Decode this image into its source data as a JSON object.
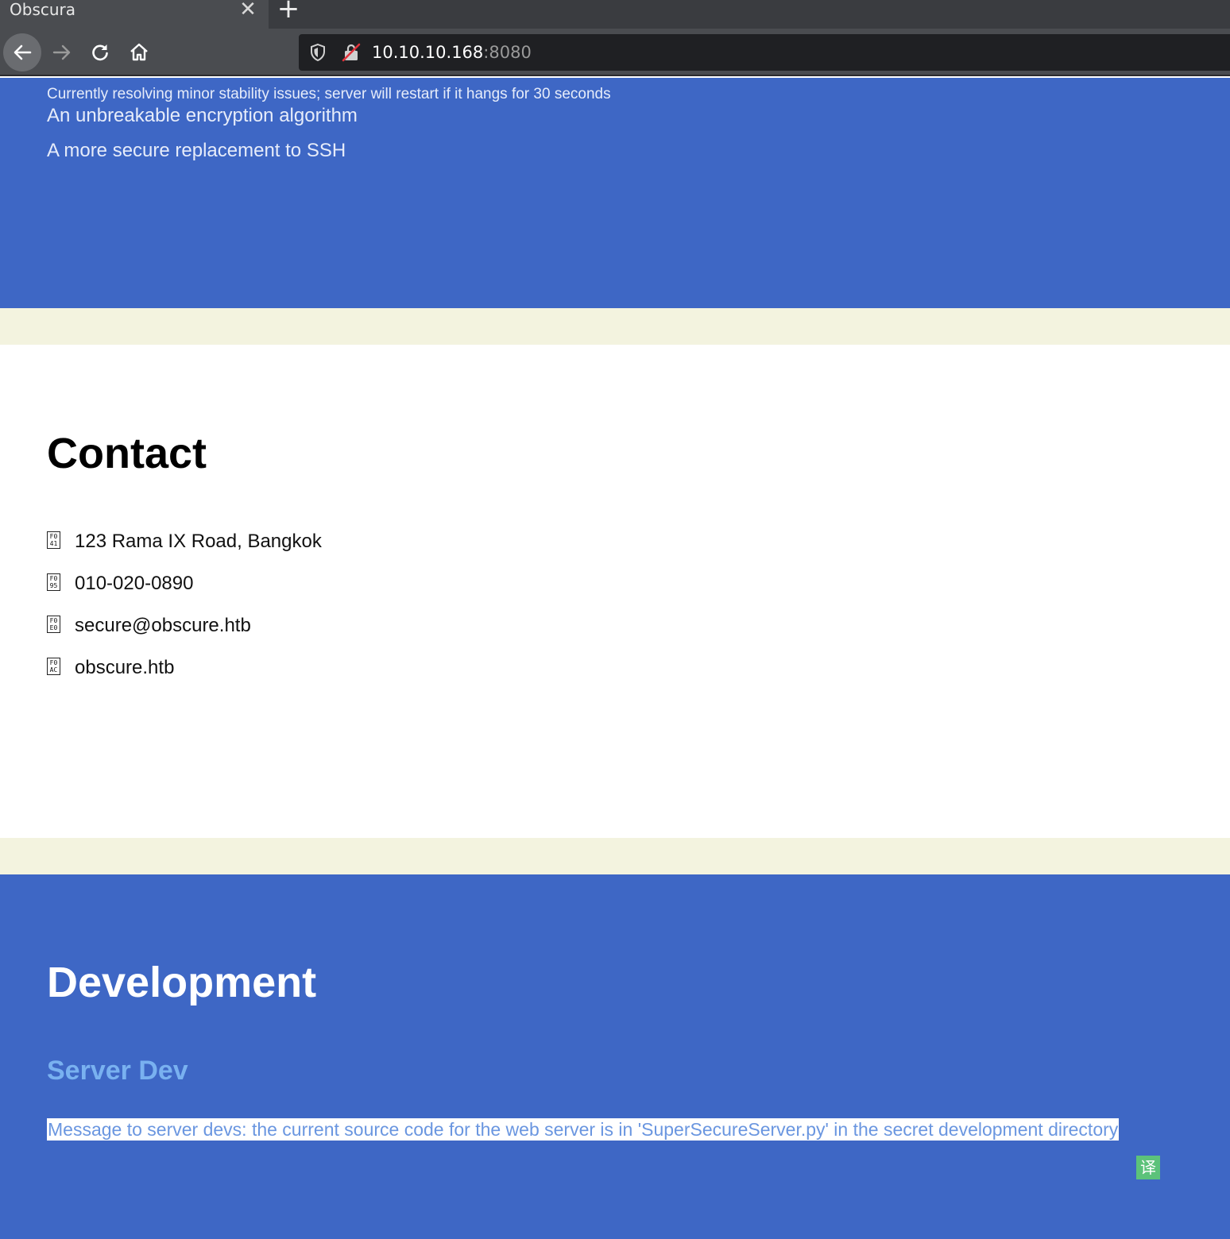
{
  "browser": {
    "tab": {
      "title": "Obscura",
      "close_glyph": "✕"
    },
    "new_tab_glyph": "+",
    "nav": {
      "back_icon": "arrow-left-icon",
      "forward_icon": "arrow-right-icon",
      "reload_icon": "reload-icon",
      "home_icon": "home-icon"
    },
    "url": {
      "host": "10.10.10.168",
      "port": ":8080",
      "shield_icon": "shield-icon",
      "lock_icon": "insecure-lock-icon"
    },
    "colors": {
      "chrome": "#4a4c50",
      "tabbar": "#3a3c40",
      "urlbar": "#1f2023"
    }
  },
  "hero": {
    "notice": "Currently resolving minor stability issues; server will restart if it hangs for 30 seconds",
    "lines": [
      "An unbreakable encryption algorithm",
      "A more secure replacement to SSH"
    ],
    "color": "#3e67c5"
  },
  "contact": {
    "title": "Contact",
    "items": [
      {
        "glyph": "F0 41",
        "text": "123 Rama IX Road, Bangkok"
      },
      {
        "glyph": "F0 95",
        "text": "010-020-0890"
      },
      {
        "glyph": "F0 E0",
        "text": "secure@obscure.htb"
      },
      {
        "glyph": "F0 AC",
        "text": "obscure.htb"
      }
    ]
  },
  "development": {
    "title": "Development",
    "subtitle": "Server Dev",
    "message": "Message to server devs: the current source code for the web server is in 'SuperSecureServer.py' in the secret development directory",
    "translate_glyph": "译",
    "accent": "#79b1f0"
  }
}
